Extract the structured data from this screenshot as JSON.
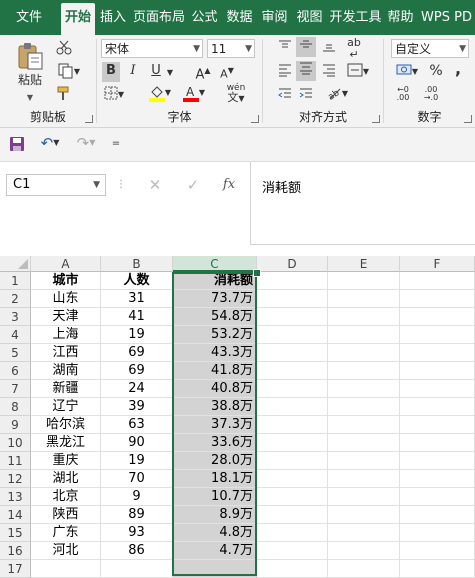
{
  "tabs": [
    {
      "label": "文件"
    },
    {
      "label": "开始"
    },
    {
      "label": "插入"
    },
    {
      "label": "页面布局"
    },
    {
      "label": "公式"
    },
    {
      "label": "数据"
    },
    {
      "label": "审阅"
    },
    {
      "label": "视图"
    },
    {
      "label": "开发工具"
    },
    {
      "label": "帮助"
    },
    {
      "label": "WPS PD"
    }
  ],
  "ribbon": {
    "clipboard": {
      "label": "剪贴板",
      "paste": "粘贴"
    },
    "font": {
      "label": "字体",
      "family": "宋体",
      "size": "11",
      "bold": "B",
      "italic": "I",
      "underline": "U",
      "grow": "A",
      "shrink": "A",
      "phonetic": "wén"
    },
    "alignment": {
      "label": "对齐方式",
      "wrap": "ab"
    },
    "number": {
      "label": "数字",
      "format": "自定义",
      "percent": "%",
      "comma": ","
    }
  },
  "colors": {
    "accent": "#217346",
    "fill_yellow": "#ffff00",
    "font_red": "#ff0000",
    "selection": "#d3d3d3"
  },
  "formula_bar": {
    "name_box": "C1",
    "fx": "fx",
    "content": "消耗额"
  },
  "grid": {
    "columns": [
      "A",
      "B",
      "C",
      "D",
      "E",
      "F"
    ],
    "selected_column": "C",
    "header": [
      "城市",
      "人数",
      "消耗额"
    ],
    "rows": [
      [
        "山东",
        "31",
        "73.7万"
      ],
      [
        "天津",
        "41",
        "54.8万"
      ],
      [
        "上海",
        "19",
        "53.2万"
      ],
      [
        "江西",
        "69",
        "43.3万"
      ],
      [
        "湖南",
        "69",
        "41.8万"
      ],
      [
        "新疆",
        "24",
        "40.8万"
      ],
      [
        "辽宁",
        "39",
        "38.8万"
      ],
      [
        "哈尔滨",
        "63",
        "37.3万"
      ],
      [
        "黑龙江",
        "90",
        "33.6万"
      ],
      [
        "重庆",
        "19",
        "28.0万"
      ],
      [
        "湖北",
        "70",
        "18.1万"
      ],
      [
        "北京",
        "9",
        "10.7万"
      ],
      [
        "陕西",
        "89",
        "8.9万"
      ],
      [
        "广东",
        "93",
        "4.8万"
      ],
      [
        "河北",
        "86",
        "4.7万"
      ]
    ],
    "row_numbers": [
      "1",
      "2",
      "3",
      "4",
      "5",
      "6",
      "7",
      "8",
      "9",
      "10",
      "11",
      "12",
      "13",
      "14",
      "15",
      "16",
      "17"
    ]
  }
}
